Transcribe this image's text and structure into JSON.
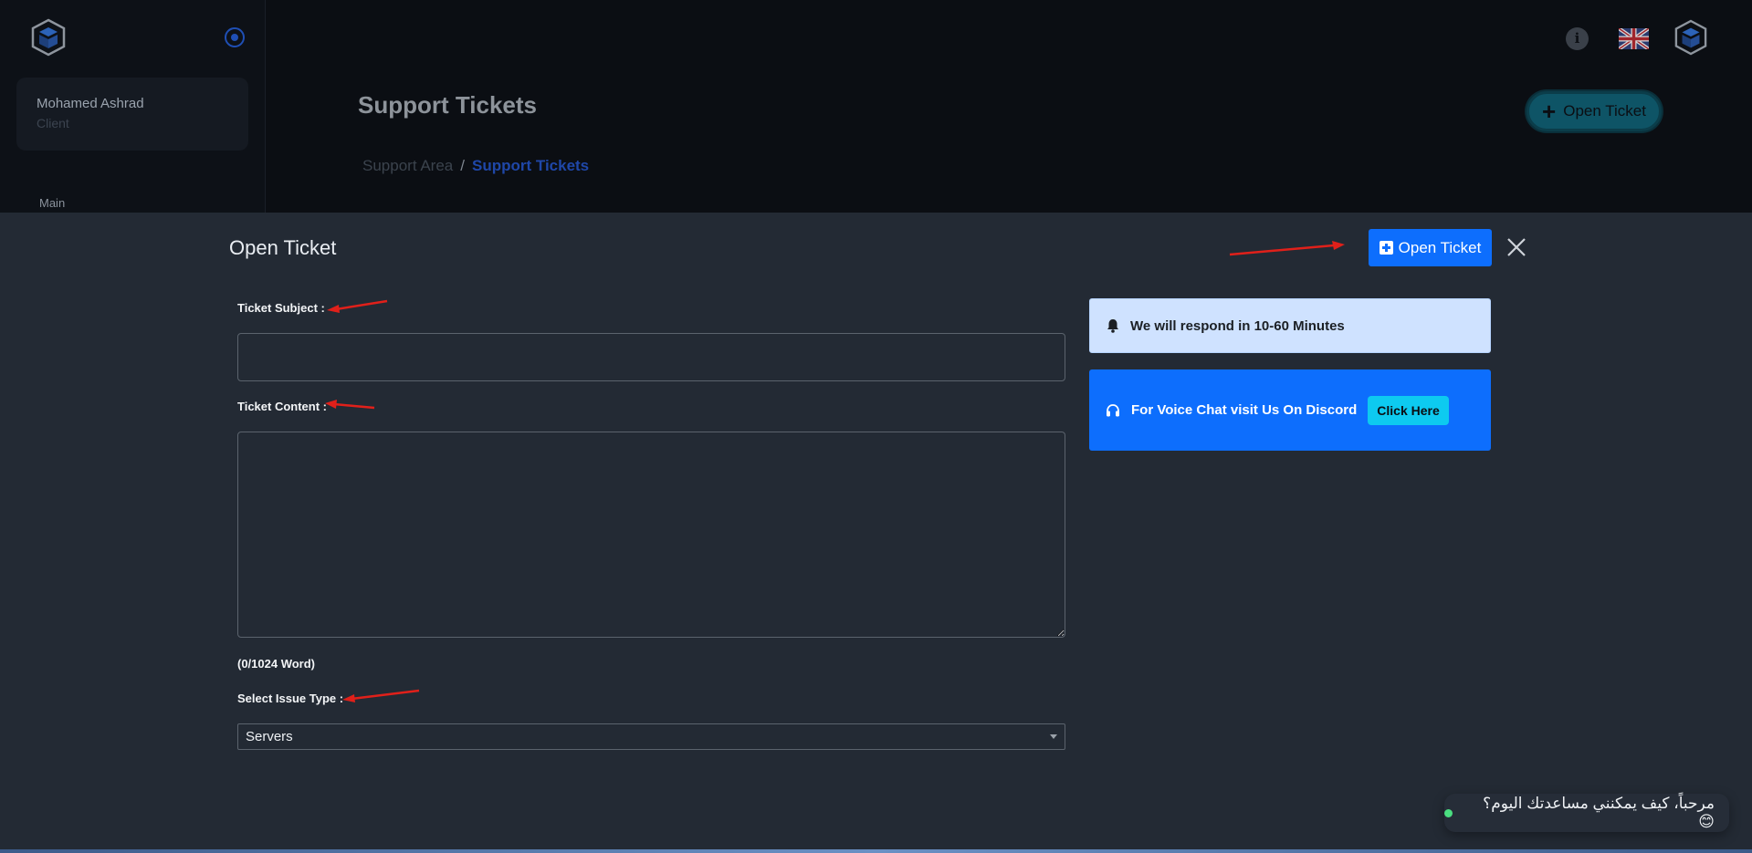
{
  "sidebar": {
    "user_name": "Mohamed Ashrad",
    "user_role": "Client",
    "section_label": "Main"
  },
  "header": {
    "page_title": "Support Tickets",
    "breadcrumb": {
      "parent": "Support Area",
      "separator": "/",
      "current": "Support Tickets"
    },
    "open_ticket_label": "Open Ticket"
  },
  "modal": {
    "title": "Open Ticket",
    "open_ticket_label": "Open Ticket",
    "subject_label": "Ticket Subject :",
    "content_label": "Ticket Content :",
    "word_count": "(0/1024 Word)",
    "issue_type_label": "Select Issue Type :",
    "issue_type_selected": "Servers",
    "subject_value": "",
    "content_value": ""
  },
  "alerts": {
    "respond_text": "We will respond in 10-60 Minutes",
    "discord_text": "For Voice Chat visit Us On Discord",
    "discord_button": "Click Here"
  },
  "chat": {
    "message": "مرحباً، كيف يمكنني مساعدتك اليوم؟ 😊"
  },
  "icons": {
    "logo": "cube-logo-icon",
    "collapse": "radio-circle-icon",
    "info": "info-icon",
    "flag": "uk-flag-icon",
    "avatar": "cube-avatar-icon",
    "bell": "bell-icon",
    "headset": "headset-icon",
    "close": "close-icon"
  },
  "colors": {
    "primary": "#0d6efd",
    "info_light": "#cfe2ff",
    "cyan": "#0dcaf0",
    "modal_bg": "#232a34",
    "annotation_arrow": "#e0201a"
  }
}
